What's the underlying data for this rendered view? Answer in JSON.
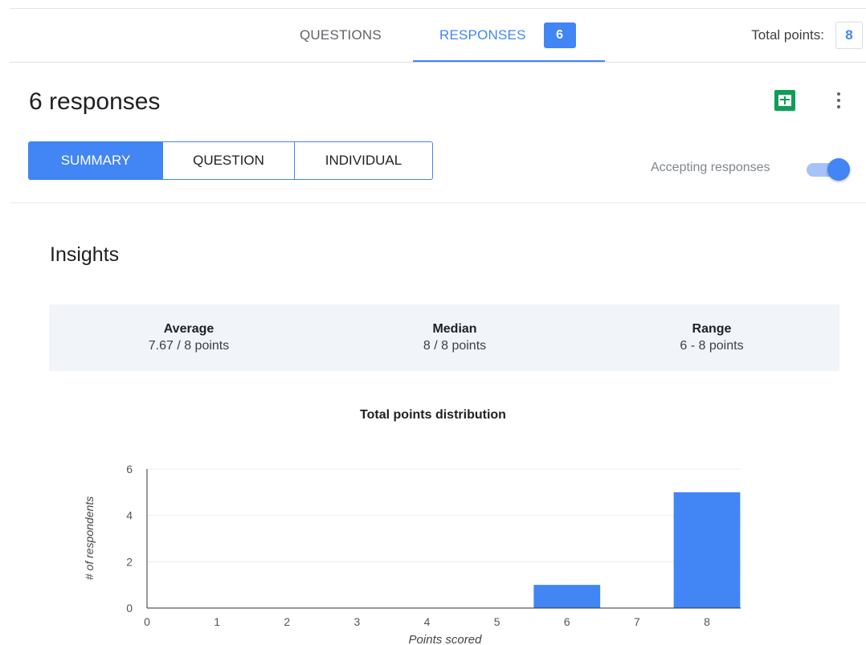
{
  "tabs": {
    "questions": "QUESTIONS",
    "responses": "RESPONSES",
    "responses_count": "6",
    "total_points_label": "Total points:",
    "total_points_value": "8"
  },
  "header": {
    "title": "6 responses",
    "sheets_icon": "google-sheets-icon",
    "more_icon": "more-vert-icon"
  },
  "view_tabs": {
    "summary": "SUMMARY",
    "question": "QUESTION",
    "individual": "INDIVIDUAL",
    "active": "SUMMARY"
  },
  "accepting": {
    "label": "Accepting responses",
    "enabled": true
  },
  "insights": {
    "title": "Insights",
    "average_label": "Average",
    "average_value": "7.67 / 8 points",
    "median_label": "Median",
    "median_value": "8 / 8 points",
    "range_label": "Range",
    "range_value": "6 - 8 points"
  },
  "colors": {
    "accent": "#4285f4",
    "sheets_green": "#0f9d58",
    "stats_bg": "#f1f4f9"
  },
  "chart_data": {
    "type": "bar",
    "title": "Total points distribution",
    "xlabel": "Points scored",
    "ylabel": "# of respondents",
    "categories": [
      "0",
      "1",
      "2",
      "3",
      "4",
      "5",
      "6",
      "7",
      "8"
    ],
    "values": [
      0,
      0,
      0,
      0,
      0,
      0,
      1,
      0,
      5
    ],
    "ylim": [
      0,
      6
    ],
    "yticks": [
      0,
      2,
      4,
      6
    ],
    "grid": true,
    "bar_color": "#4285f4"
  }
}
